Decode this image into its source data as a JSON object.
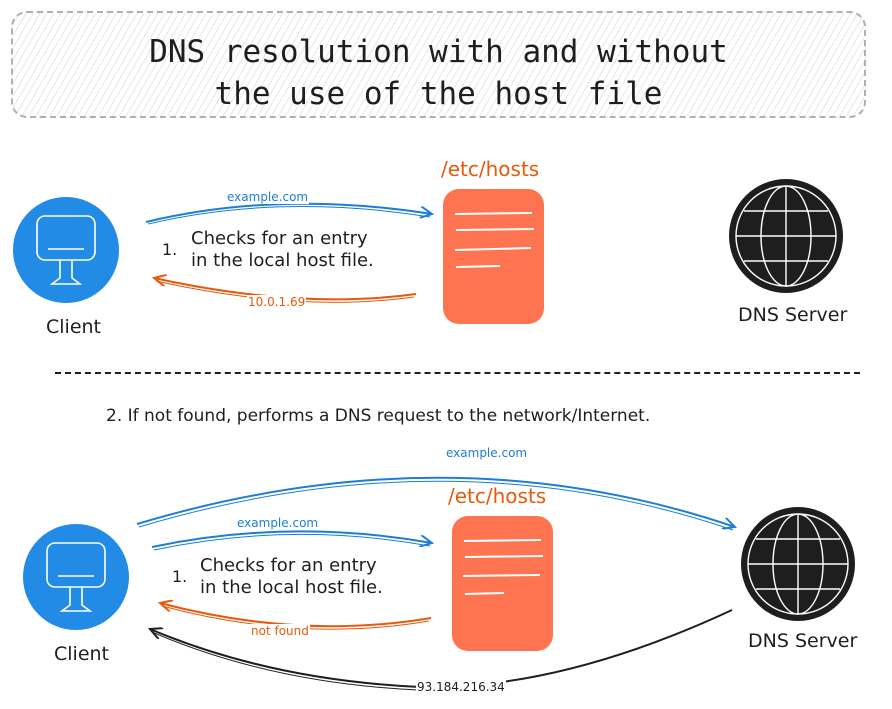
{
  "title": {
    "line1": "DNS resolution with and without",
    "line2": "the use of the host file"
  },
  "colors": {
    "client_blue": "#228be6",
    "hosts_orange": "#ff7450",
    "arrow_blue": "#1c7ed6",
    "arrow_orange": "#e8590c",
    "dark": "#1e1e1e"
  },
  "scenario1": {
    "client_label": "Client",
    "hosts_label": "/etc/hosts",
    "dns_label": "DNS Server",
    "step_number": "1.",
    "step_line1": "Checks for an entry",
    "step_line2": "in the local host file.",
    "request_label": "example.com",
    "response_label": "10.0.1.69"
  },
  "divider_note": "2. If not found, performs a DNS request to the network/Internet.",
  "scenario2": {
    "client_label": "Client",
    "hosts_label": "/etc/hosts",
    "dns_label": "DNS Server",
    "step_number": "1.",
    "step_line1": "Checks for an entry",
    "step_line2": "in the local host file.",
    "request_label": "example.com",
    "response_label": "not found",
    "dns_request_label": "example.com",
    "dns_response_label": "93.184.216.34"
  }
}
